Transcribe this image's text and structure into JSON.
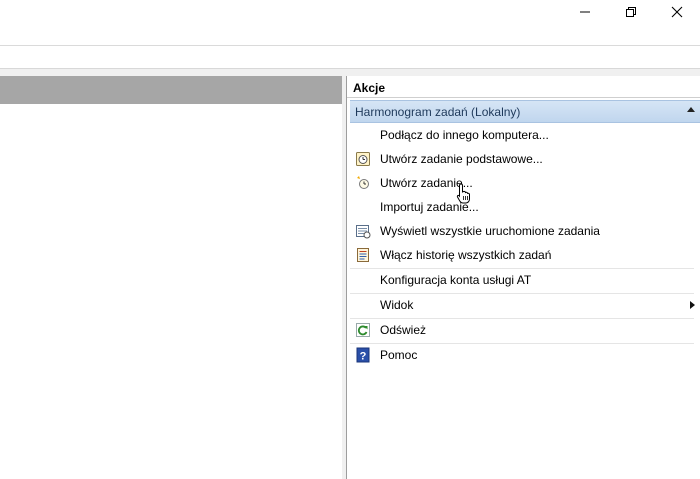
{
  "window": {
    "controls": {
      "minimize_icon": "minimize-icon",
      "maximize_icon": "restore-icon",
      "close_icon": "close-icon"
    }
  },
  "actions_panel": {
    "title": "Akcje",
    "section": {
      "title": "Harmonogram zadań (Lokalny)",
      "collapse_icon": "chevron-up-icon"
    },
    "items": [
      {
        "label": "Podłącz do innego komputera...",
        "icon": "none"
      },
      {
        "label": "Utwórz zadanie podstawowe...",
        "icon": "basic-task-icon"
      },
      {
        "label": "Utwórz zadanie...",
        "icon": "create-task-icon"
      },
      {
        "label": "Importuj zadanie...",
        "icon": "none"
      },
      {
        "label": "Wyświetl wszystkie uruchomione zadania",
        "icon": "running-tasks-icon"
      },
      {
        "label": "Włącz historię wszystkich zadań",
        "icon": "history-icon"
      },
      {
        "label": "Konfiguracja konta usługi AT",
        "icon": "none"
      },
      {
        "label": "Widok",
        "icon": "none",
        "submenu": true
      },
      {
        "label": "Odśwież",
        "icon": "refresh-icon"
      },
      {
        "label": "Pomoc",
        "icon": "help-icon"
      }
    ]
  },
  "colors": {
    "section_bg": "#c8dbf0",
    "section_text": "#1e395b",
    "left_header": "#a6a6a6"
  }
}
